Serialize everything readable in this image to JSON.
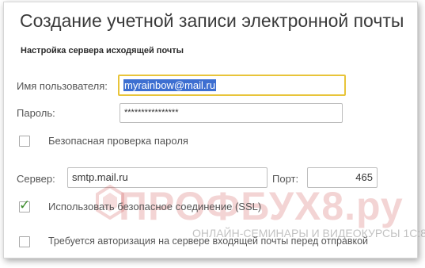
{
  "window": {
    "title": "Создание учетной записи электронной почты",
    "section_title": "Настройка сервера исходящей почты"
  },
  "form": {
    "username_label": "Имя пользователя:",
    "username_value": "myrainbow@mail.ru",
    "password_label": "Пароль:",
    "password_value": "****************",
    "secure_password_label": "Безопасная проверка пароля",
    "secure_password_checked": false,
    "server_label": "Сервер:",
    "server_value": "smtp.mail.ru",
    "port_label": "Порт:",
    "port_value": "465",
    "ssl_label": "Использовать безопасное соединение (SSL)",
    "ssl_checked": true,
    "auth_incoming_label": "Требуется авторизация на сервере входящей почты перед отправкой",
    "auth_incoming_checked": false
  },
  "watermark": {
    "brand": "ПРОФБУХ8.ру",
    "tagline": "ОНЛАЙН-СЕМИНАРЫ И ВИДЕОКУРСЫ 1С:8"
  },
  "colors": {
    "focus_border": "#e8c43a",
    "selection": "#3d6fd1",
    "checkmark": "#3d8c2c"
  }
}
